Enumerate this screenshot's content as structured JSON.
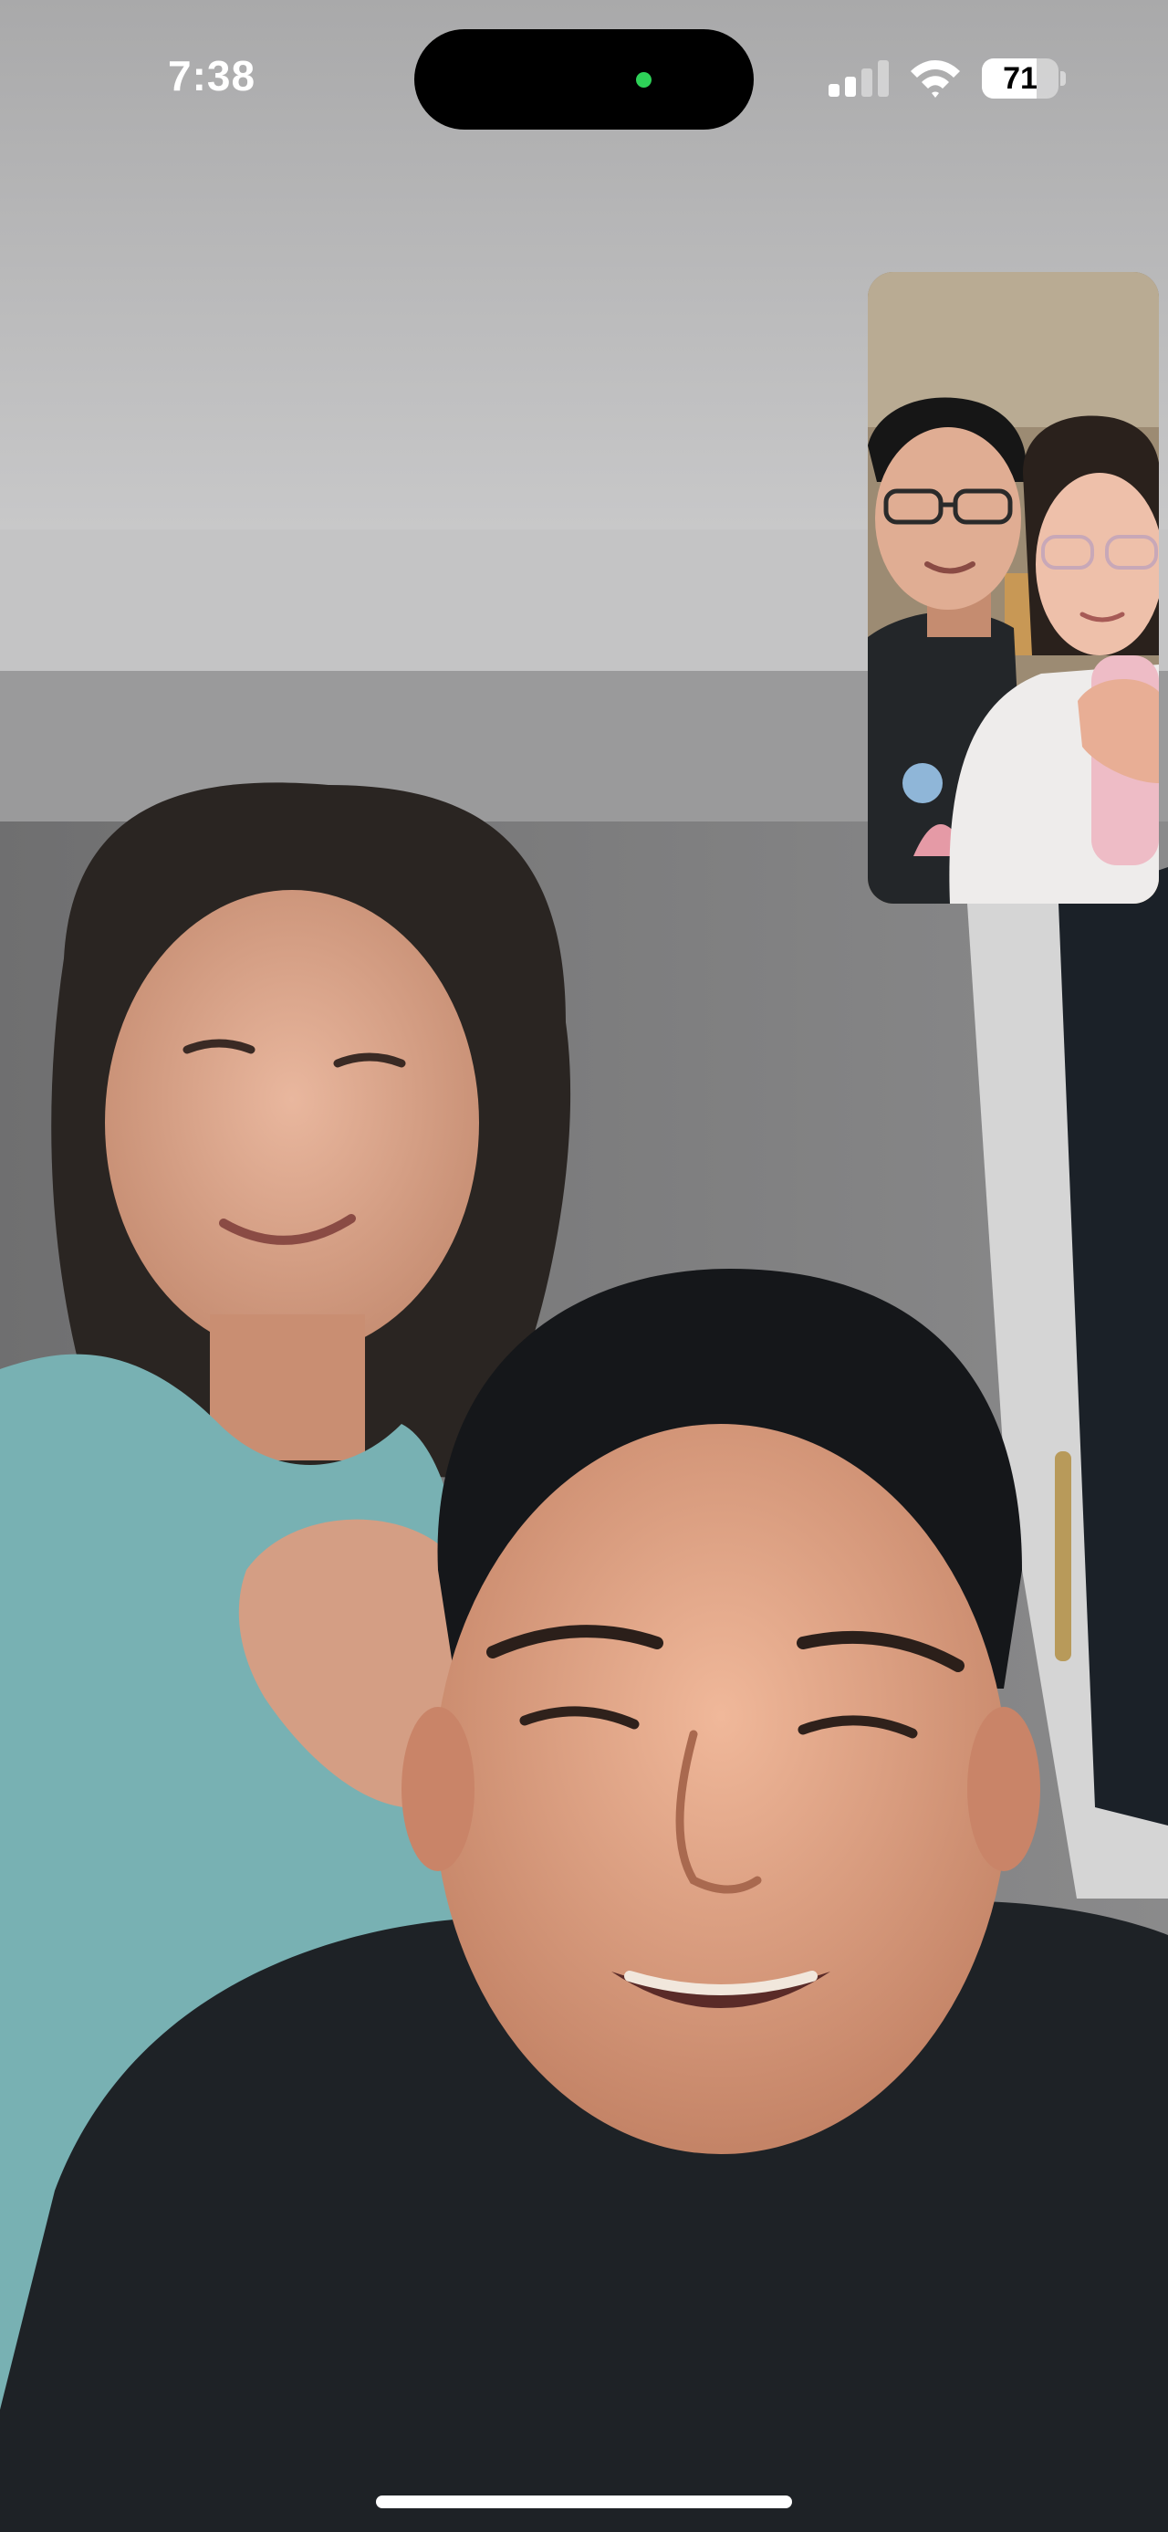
{
  "status_bar": {
    "time": "7:38",
    "camera_indicator_color": "#2ed158",
    "signal_icon": "cellular-signal-icon",
    "signal_bars_active": 2,
    "signal_bars_total": 4,
    "wifi_icon": "wifi-icon",
    "battery_icon": "battery-icon",
    "battery_level": "71",
    "battery_fraction": 0.71
  },
  "call": {
    "remote_video": "remote-video-feed",
    "self_view": "self-view-feed"
  }
}
